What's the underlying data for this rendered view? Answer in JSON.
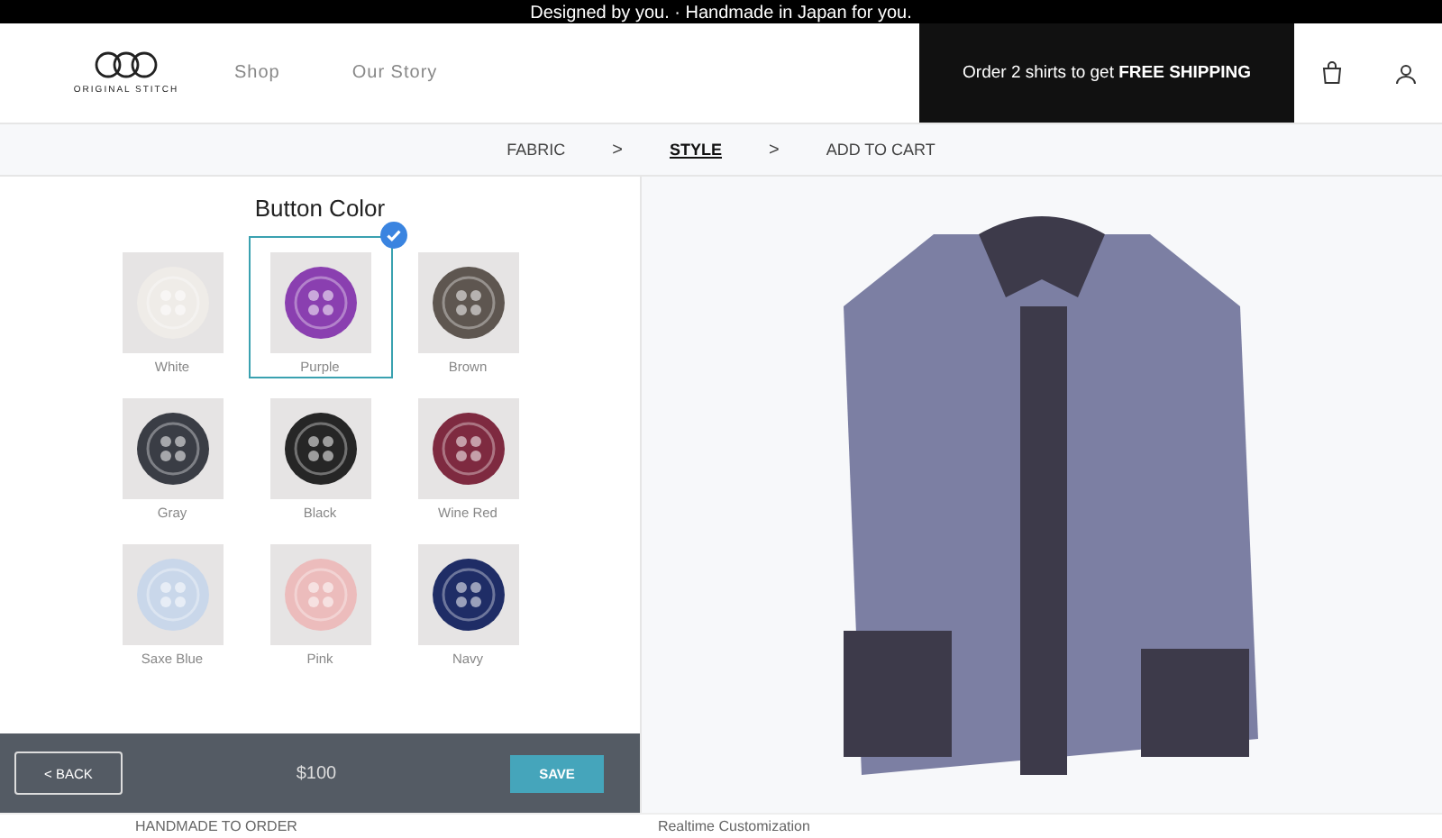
{
  "announcement": "Designed by you. · Handmade in Japan for you.",
  "header": {
    "logo_text": "ORIGINAL STITCH",
    "nav": [
      "Shop",
      "Our Story"
    ],
    "promo": {
      "text": "Order 2 shirts to get ",
      "bold": "FREE SHIPPING"
    }
  },
  "steps": [
    {
      "label": "FABRIC",
      "selected": false
    },
    {
      "label": "STYLE",
      "selected": true
    },
    {
      "label": "ADD TO CART",
      "selected": false
    }
  ],
  "separators": [
    ">",
    ">"
  ],
  "panel": {
    "title": "Button Color",
    "options": [
      {
        "label": "White",
        "color": "#efece8",
        "selected": false
      },
      {
        "label": "Purple",
        "color": "#8a3fb0",
        "selected": true
      },
      {
        "label": "Brown",
        "color": "#5e5650",
        "selected": false
      },
      {
        "label": "Gray",
        "color": "#3a3d45",
        "selected": false
      },
      {
        "label": "Black",
        "color": "#262626",
        "selected": false
      },
      {
        "label": "Wine Red",
        "color": "#7e2a40",
        "selected": false
      },
      {
        "label": "Saxe Blue",
        "color": "#c9d7ea",
        "selected": false
      },
      {
        "label": "Pink",
        "color": "#ecbcbc",
        "selected": false
      },
      {
        "label": "Navy",
        "color": "#1f2d66",
        "selected": false
      }
    ]
  },
  "footer": {
    "back": "< BACK",
    "price": "$100",
    "save": "SAVE"
  },
  "bottom_strip": [
    "HANDMADE TO ORDER",
    "Realtime Customization"
  ]
}
